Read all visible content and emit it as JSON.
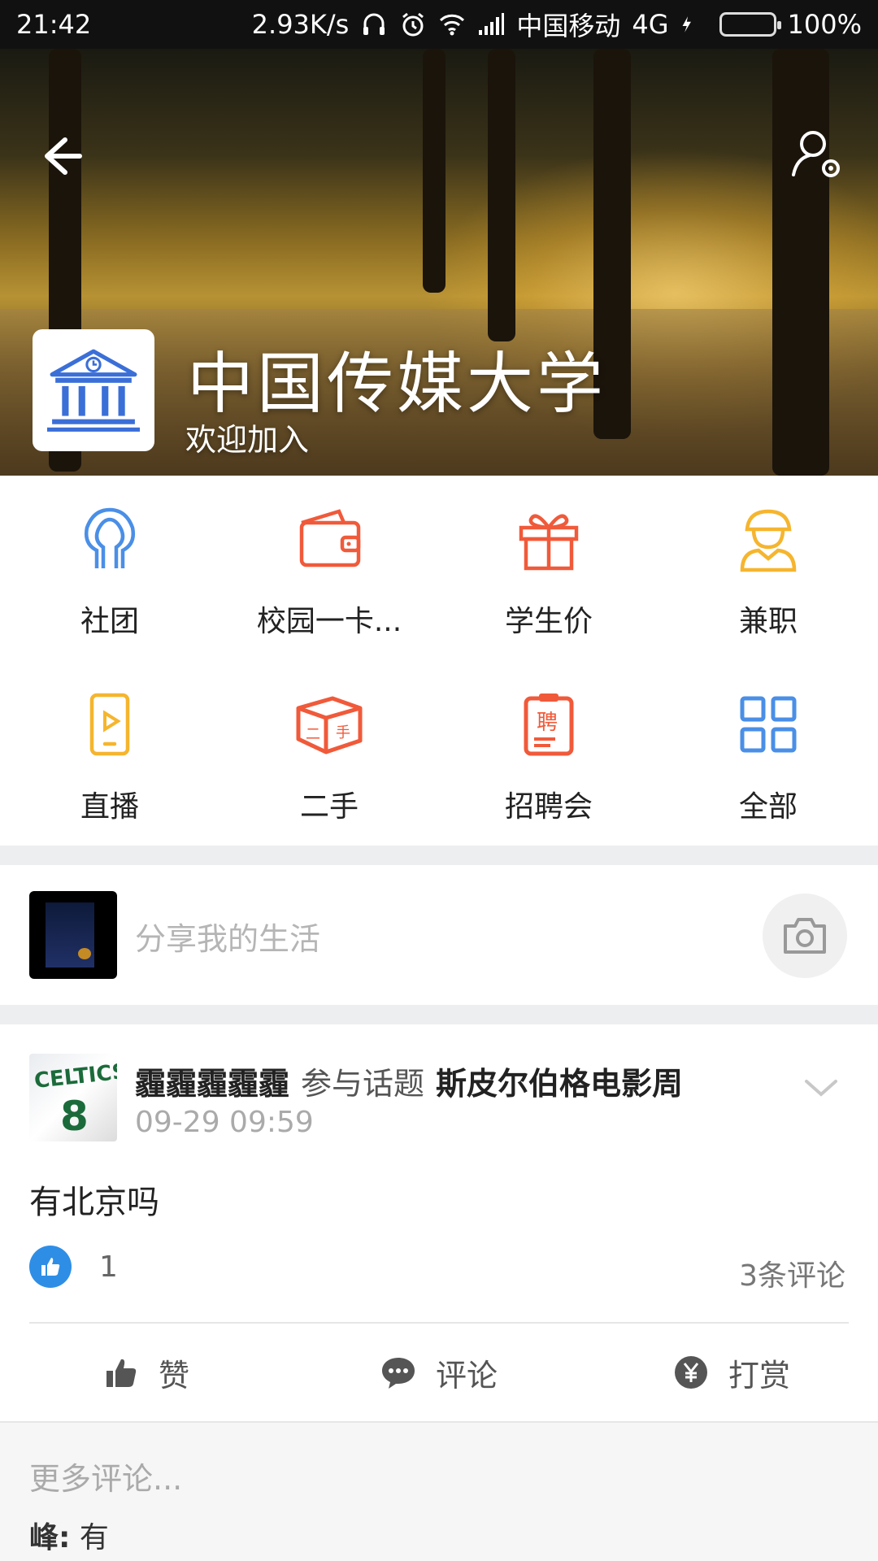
{
  "status_bar": {
    "time": "21:42",
    "speed": "2.93K/s",
    "carrier": "中国移动",
    "network": "4G",
    "battery": "100%"
  },
  "header": {
    "school_name": "中国传媒大学",
    "welcome": "欢迎加入"
  },
  "grid": {
    "items": [
      {
        "label": "社团",
        "icon": "people-icon",
        "color": "#4a8fe7"
      },
      {
        "label": "校园一卡...",
        "icon": "wallet-icon",
        "color": "#f05a3a"
      },
      {
        "label": "学生价",
        "icon": "gift-icon",
        "color": "#f05a3a"
      },
      {
        "label": "兼职",
        "icon": "worker-icon",
        "color": "#f5b52e"
      },
      {
        "label": "直播",
        "icon": "live-phone-icon",
        "color": "#f5b52e"
      },
      {
        "label": "二手",
        "icon": "box-icon",
        "color": "#f05a3a"
      },
      {
        "label": "招聘会",
        "icon": "recruit-icon",
        "color": "#f05a3a"
      },
      {
        "label": "全部",
        "icon": "grid-icon",
        "color": "#4a8fe7"
      }
    ]
  },
  "share": {
    "placeholder": "分享我的生活"
  },
  "post": {
    "user": "霾霾霾霾霾",
    "action": "参与话题",
    "topic": "斯皮尔伯格电影周",
    "time": "09-29 09:59",
    "content": "有北京吗",
    "like_count": "1",
    "comment_count": "3条评论",
    "actions": {
      "like": "赞",
      "comment": "评论",
      "reward": "打赏"
    },
    "avatar_text": "CELTICS",
    "avatar_number": "8"
  },
  "comments": {
    "more_label": "更多评论...",
    "items": [
      {
        "author": "峰:",
        "text": "有"
      }
    ]
  }
}
